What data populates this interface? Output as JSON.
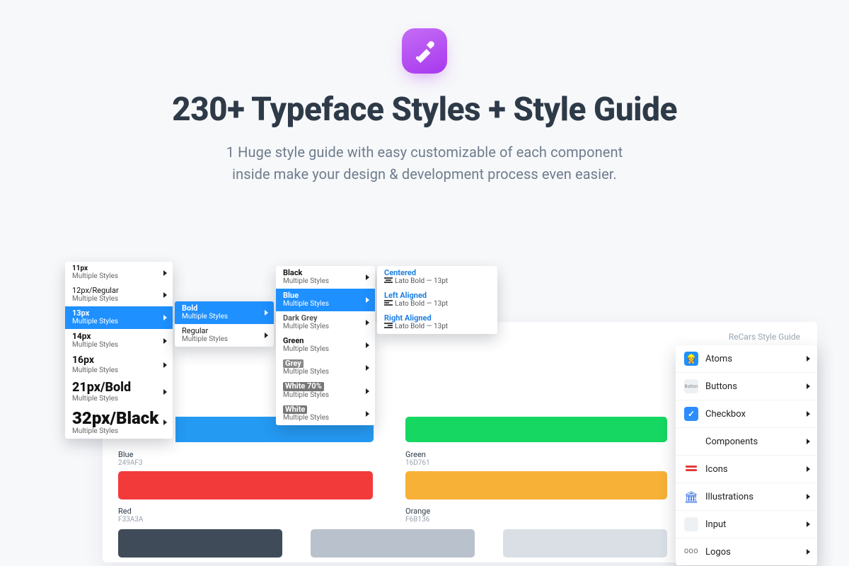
{
  "hero": {
    "title": "230+ Typeface Styles + Style Guide",
    "sub_l1": "1 Huge style guide with easy customizable of each component",
    "sub_l2": "inside make your design & development process even easier."
  },
  "guide": {
    "title": "ReCars Style Guide",
    "swatches": {
      "blue": {
        "name": "Blue",
        "hex": "249AF3"
      },
      "green": {
        "name": "Green",
        "hex": "16D761"
      },
      "red": {
        "name": "Red",
        "hex": "F33A3A"
      },
      "orange": {
        "name": "Orange",
        "hex": "F6B136"
      }
    }
  },
  "size_menu": {
    "sub": "Multiple Styles",
    "items": [
      "11px",
      "12px/Regular",
      "13px",
      "14px",
      "16px",
      "21px/Bold",
      "32px/Black"
    ],
    "selected": "13px"
  },
  "weight_menu": {
    "sub": "Multiple Styles",
    "items": [
      "Bold",
      "Regular"
    ],
    "selected": "Bold"
  },
  "color_menu": {
    "sub": "Multiple Styles",
    "items": [
      "Black",
      "Blue",
      "Dark Grey",
      "Green",
      "Grey",
      "White 70%",
      "White"
    ],
    "selected": "Blue"
  },
  "align_menu": {
    "sub": "Lato Bold — 13pt",
    "items": [
      "Centered",
      "Left Aligned",
      "Right Aligned"
    ]
  },
  "sidebar": {
    "atoms_emoji": "👷",
    "items": [
      "Atoms",
      "Buttons",
      "Checkbox",
      "Components",
      "Icons",
      "Illustrations",
      "Input",
      "Logos"
    ],
    "button_tag": "Button",
    "check_mark": "✓",
    "illus_glyph": "🏛",
    "logos_txt": "ΟΟΟ"
  }
}
